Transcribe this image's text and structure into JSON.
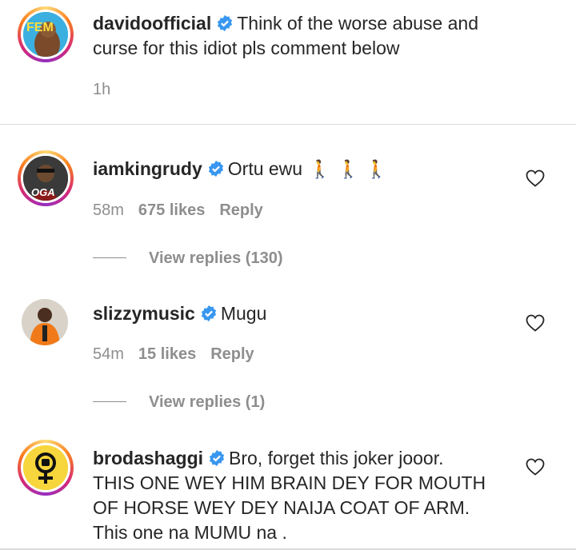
{
  "post": {
    "username": "davidoofficial",
    "caption_line1": "Think of the worse abuse and",
    "caption_line2": "curse for this idiot pls comment below",
    "time": "1h",
    "avatar_label": "FEM"
  },
  "comments": [
    {
      "username": "iamkingrudy",
      "text": "Ortu ewu",
      "emoji": "🚶🚶🚶",
      "time": "58m",
      "likes": "675 likes",
      "reply": "Reply",
      "view_replies": "View replies (130)",
      "avatar_label": "OGA"
    },
    {
      "username": "slizzymusic",
      "text": "Mugu",
      "time": "54m",
      "likes": "15 likes",
      "reply": "Reply",
      "view_replies": "View replies (1)"
    },
    {
      "username": "brodashaggi",
      "line1": "Bro, forget this joker jooor.",
      "line2": "THIS ONE WEY HIM BRAIN DEY FOR MOUTH",
      "line3": "OF HORSE WEY DEY NAIJA COAT OF ARM.",
      "line4": "This one na MUMU na ."
    }
  ],
  "colors": {
    "verified": "#3897f0",
    "muted": "#8e8e8e",
    "text": "#262626"
  }
}
